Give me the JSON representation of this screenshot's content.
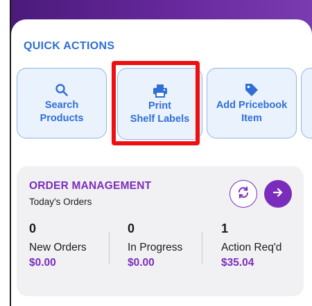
{
  "colors": {
    "accent_blue": "#2f6fd6",
    "accent_purple": "#7a2dbb",
    "tile_bg": "#eaf2fd",
    "highlight": "#ee1010"
  },
  "quick_actions": {
    "title": "QUICK ACTIONS",
    "tiles": [
      {
        "label": "Search\nProducts",
        "icon": "search-icon"
      },
      {
        "label": "Print\nShelf Labels",
        "icon": "printer-icon"
      },
      {
        "label": "Add Pricebook\nItem",
        "icon": "tag-icon"
      }
    ]
  },
  "order_management": {
    "title": "ORDER MANAGEMENT",
    "subtitle": "Today's Orders",
    "refresh_icon": "refresh-icon",
    "go_icon": "arrow-right-icon",
    "stats": [
      {
        "count": "0",
        "label": "New Orders",
        "amount": "$0.00"
      },
      {
        "count": "0",
        "label": "In Progress",
        "amount": "$0.00"
      },
      {
        "count": "1",
        "label": "Action Req'd",
        "amount": "$35.04"
      }
    ]
  }
}
